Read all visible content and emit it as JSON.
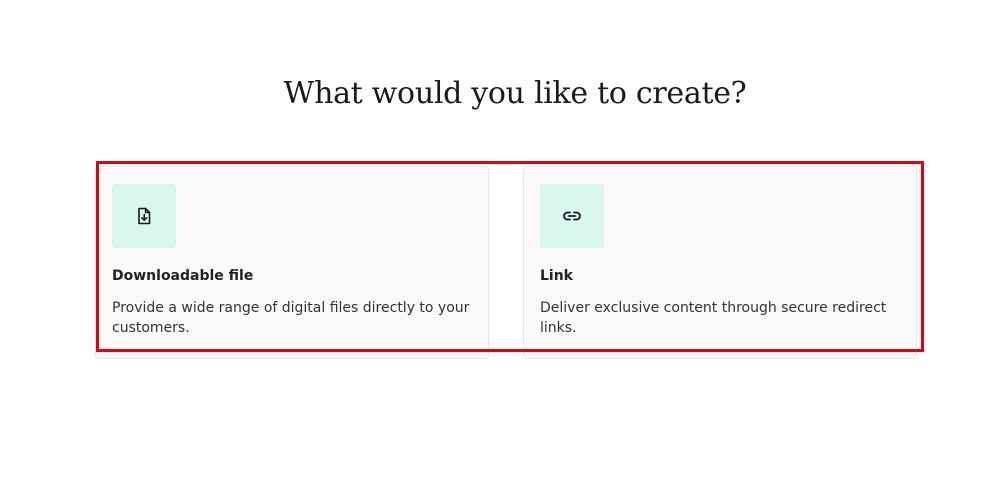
{
  "header": {
    "title": "What would you like to create?"
  },
  "options": [
    {
      "icon": "file-download-icon",
      "title": "Downloadable file",
      "description": "Provide a wide range of digital files directly to your customers."
    },
    {
      "icon": "link-icon",
      "title": "Link",
      "description": "Deliver exclusive content through secure redirect links."
    }
  ],
  "colors": {
    "icon_bg": "#d8f7ef",
    "card_bg": "#f9f9f9",
    "highlight": "#e0000f"
  }
}
